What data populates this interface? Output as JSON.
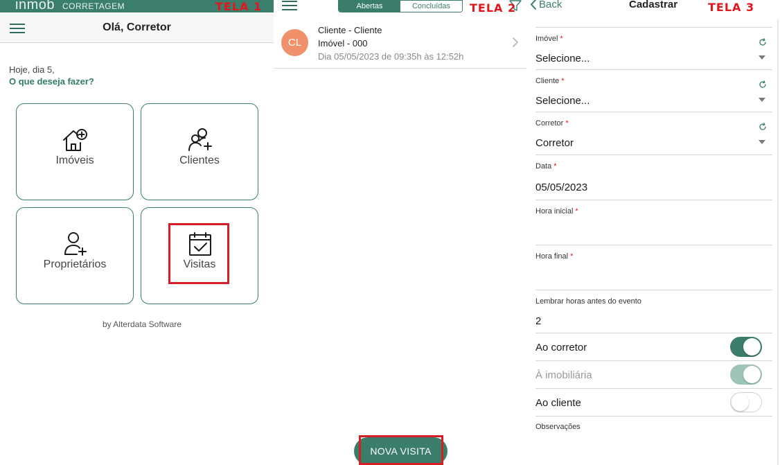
{
  "screen1": {
    "brand_logo": "inmob",
    "brand_sub": "CORRETAGEM",
    "tela_label": "TELA 1",
    "nav_title": "Olá, Corretor",
    "greeting": "Hoje, dia 5,",
    "question": "O que deseja fazer?",
    "tiles": [
      {
        "label": "Imóveis",
        "icon": "house-plus-icon"
      },
      {
        "label": "Clientes",
        "icon": "users-plus-icon"
      },
      {
        "label": "Proprietários",
        "icon": "user-plus-icon"
      },
      {
        "label": "Visitas",
        "icon": "calendar-check-icon"
      }
    ],
    "footer": "by Alterdata Software",
    "accent_color": "#3a7d6b",
    "highlight_color": "#d71d25"
  },
  "screen2": {
    "tela_label": "TELA 2",
    "tabs": [
      {
        "label": "Abertas",
        "active": true
      },
      {
        "label": "Concluídas",
        "active": false
      }
    ],
    "visit": {
      "avatar_initials": "CL",
      "line1": "Cliente - Cliente",
      "line2": "Imóvel - 000",
      "line3": "Dia 05/05/2023 de 09:35h às 12:52h"
    },
    "fab_label": "NOVA VISITA",
    "avatar_color": "#f0916b"
  },
  "screen3": {
    "back_label": "Back",
    "title": "Cadastrar",
    "tela_label": "TELA 3",
    "fields": [
      {
        "label": "Imóvel",
        "value": "Selecione...",
        "required": "*"
      },
      {
        "label": "Cliente",
        "value": "Selecione...",
        "required": "*"
      },
      {
        "label": "Corretor",
        "value": "Corretor",
        "required": "*"
      },
      {
        "label": "Data",
        "value": "05/05/2023",
        "required": "*"
      },
      {
        "label": "Hora inicial",
        "value": "",
        "required": "*"
      },
      {
        "label": "Hora final",
        "value": "",
        "required": "*"
      },
      {
        "label": "Lembrar horas antes do evento",
        "value": "2",
        "required": ""
      }
    ],
    "toggles": [
      {
        "label": "Ao corretor",
        "state": "on"
      },
      {
        "label": "À imobiliária",
        "state": "on-disabled"
      },
      {
        "label": "Ao cliente",
        "state": "off"
      }
    ],
    "observations_label": "Observações"
  }
}
